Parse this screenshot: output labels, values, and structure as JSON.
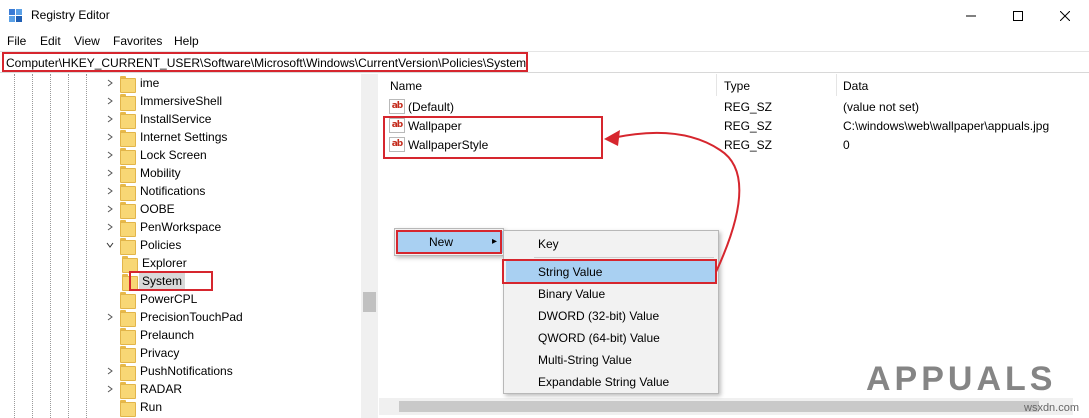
{
  "window": {
    "title": "Registry Editor"
  },
  "menu": [
    "File",
    "Edit",
    "View",
    "Favorites",
    "Help"
  ],
  "address": "Computer\\HKEY_CURRENT_USER\\Software\\Microsoft\\Windows\\CurrentVersion\\Policies\\System",
  "tree": {
    "items": [
      {
        "label": "ime",
        "expander": "collapsed"
      },
      {
        "label": "ImmersiveShell",
        "expander": "collapsed"
      },
      {
        "label": "InstallService",
        "expander": "collapsed"
      },
      {
        "label": "Internet Settings",
        "expander": "collapsed"
      },
      {
        "label": "Lock Screen",
        "expander": "collapsed"
      },
      {
        "label": "Mobility",
        "expander": "collapsed"
      },
      {
        "label": "Notifications",
        "expander": "collapsed"
      },
      {
        "label": "OOBE",
        "expander": "collapsed"
      },
      {
        "label": "PenWorkspace",
        "expander": "collapsed"
      },
      {
        "label": "Policies",
        "expander": "expanded"
      },
      {
        "label": "Explorer",
        "expander": "none"
      },
      {
        "label": "System",
        "expander": "none",
        "selected": true
      },
      {
        "label": "PowerCPL",
        "expander": "none"
      },
      {
        "label": "PrecisionTouchPad",
        "expander": "collapsed"
      },
      {
        "label": "Prelaunch",
        "expander": "none"
      },
      {
        "label": "Privacy",
        "expander": "none"
      },
      {
        "label": "PushNotifications",
        "expander": "collapsed"
      },
      {
        "label": "RADAR",
        "expander": "collapsed"
      },
      {
        "label": "Run",
        "expander": "none"
      }
    ]
  },
  "list": {
    "columns": [
      "Name",
      "Type",
      "Data"
    ],
    "rows": [
      {
        "name": "(Default)",
        "type": "REG_SZ",
        "data": "(value not set)"
      },
      {
        "name": "Wallpaper",
        "type": "REG_SZ",
        "data": "C:\\windows\\web\\wallpaper\\appuals.jpg"
      },
      {
        "name": "WallpaperStyle",
        "type": "REG_SZ",
        "data": "0"
      }
    ]
  },
  "context_menu": {
    "new_label": "New",
    "submenu": [
      "Key",
      "String Value",
      "Binary Value",
      "DWORD (32-bit) Value",
      "QWORD (64-bit) Value",
      "Multi-String Value",
      "Expandable String Value"
    ],
    "highlighted": "String Value"
  },
  "watermark": {
    "brand": "APPUALS",
    "site": "wsxdn.com"
  },
  "colors": {
    "highlight_box": "#d6262e",
    "menu_hot": "#a9d0f2",
    "folder": "#f8d775"
  }
}
